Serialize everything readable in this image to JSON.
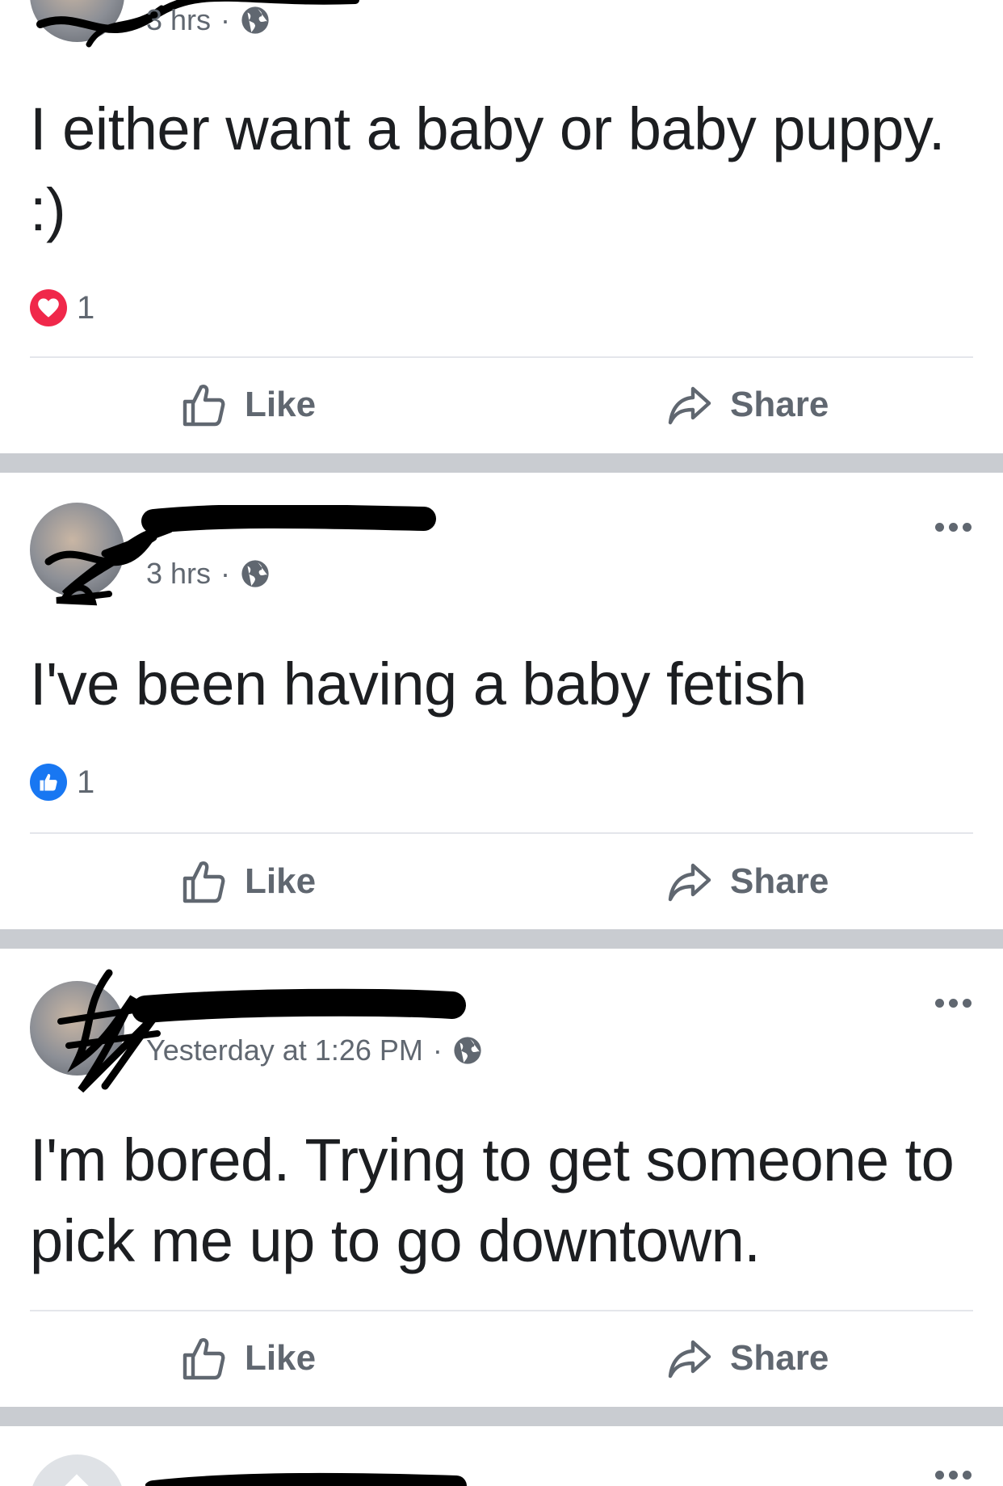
{
  "posts": [
    {
      "timestamp": "3 hrs",
      "separator": "·",
      "privacy_icon": "globe-icon",
      "text": "I either want a baby or baby puppy. :)",
      "reaction": {
        "type": "love",
        "icon": "heart-icon",
        "count": "1",
        "color": "#f0284a"
      },
      "actions": {
        "like": "Like",
        "share": "Share"
      }
    },
    {
      "timestamp": "3 hrs",
      "separator": "·",
      "privacy_icon": "globe-icon",
      "text": "I've been having a baby fetish",
      "reaction": {
        "type": "like",
        "icon": "thumbs-up-icon",
        "count": "1",
        "color": "#1877f2"
      },
      "actions": {
        "like": "Like",
        "share": "Share"
      }
    },
    {
      "timestamp": "Yesterday at 1:26 PM",
      "separator": "·",
      "privacy_icon": "globe-icon",
      "text": "I'm bored. Trying to get someone to pick me up to go downtown.",
      "actions": {
        "like": "Like",
        "share": "Share"
      }
    }
  ],
  "colors": {
    "separator": "#c9ccd1",
    "secondary_text": "#606770",
    "divider": "#e4e6eb"
  }
}
